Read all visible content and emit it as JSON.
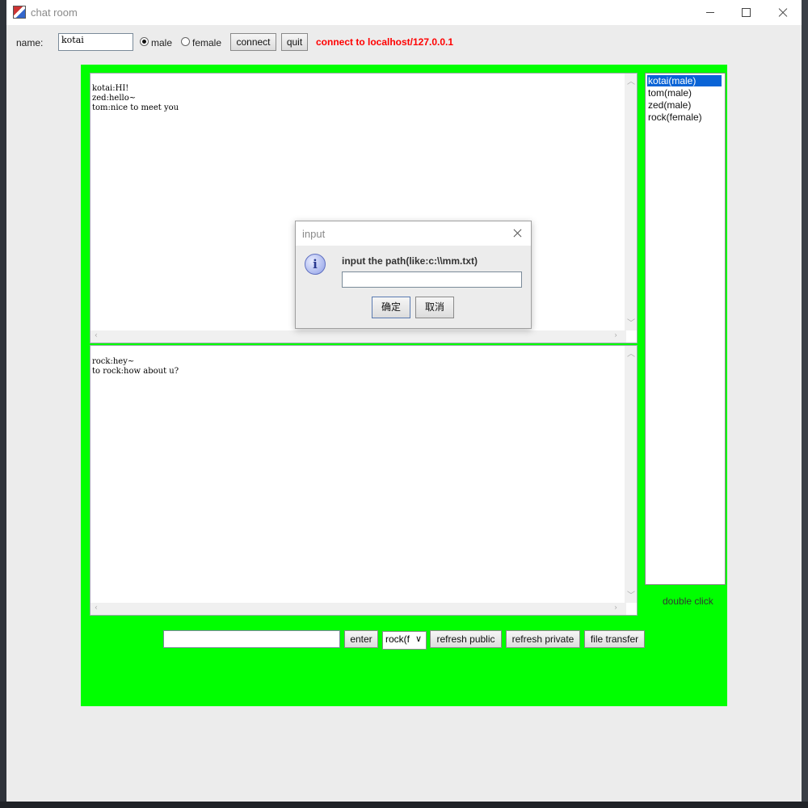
{
  "window": {
    "title": "chat room"
  },
  "top_bar": {
    "name_label": "name:",
    "name_value": "kotai",
    "gender_options": [
      {
        "label": "male",
        "selected": true
      },
      {
        "label": "female",
        "selected": false
      }
    ],
    "connect_button": "connect",
    "quit_button": "quit",
    "status_text": "connect to localhost/127.0.0.1",
    "status_color": "#ff0000"
  },
  "public_chat": {
    "lines": [
      "kotai:HI!",
      "zed:hello~",
      "tom:nice to meet you"
    ]
  },
  "private_chat": {
    "lines": [
      "rock:hey~",
      "to rock:how about u?"
    ]
  },
  "user_list": {
    "users": [
      {
        "label": "kotai(male)",
        "selected": true
      },
      {
        "label": "tom(male)",
        "selected": false
      },
      {
        "label": "zed(male)",
        "selected": false
      },
      {
        "label": "rock(female)",
        "selected": false
      }
    ],
    "hint": "double click"
  },
  "bottom_bar": {
    "message_value": "",
    "enter_button": "enter",
    "recipient_select": "rock(f",
    "refresh_public_button": "refresh public",
    "refresh_private_button": "refresh private",
    "file_transfer_button": "file transfer"
  },
  "dialog": {
    "title": "input",
    "message": "input the path(like:c:\\\\mm.txt)",
    "input_value": "",
    "ok_button": "确定",
    "cancel_button": "取消"
  },
  "colors": {
    "panel_green": "#00ff00",
    "selection_blue": "#0a64d6"
  },
  "icons": [
    "app-icon",
    "minimize-icon",
    "maximize-icon",
    "close-icon",
    "info-icon",
    "dropdown-chevron-icon"
  ]
}
